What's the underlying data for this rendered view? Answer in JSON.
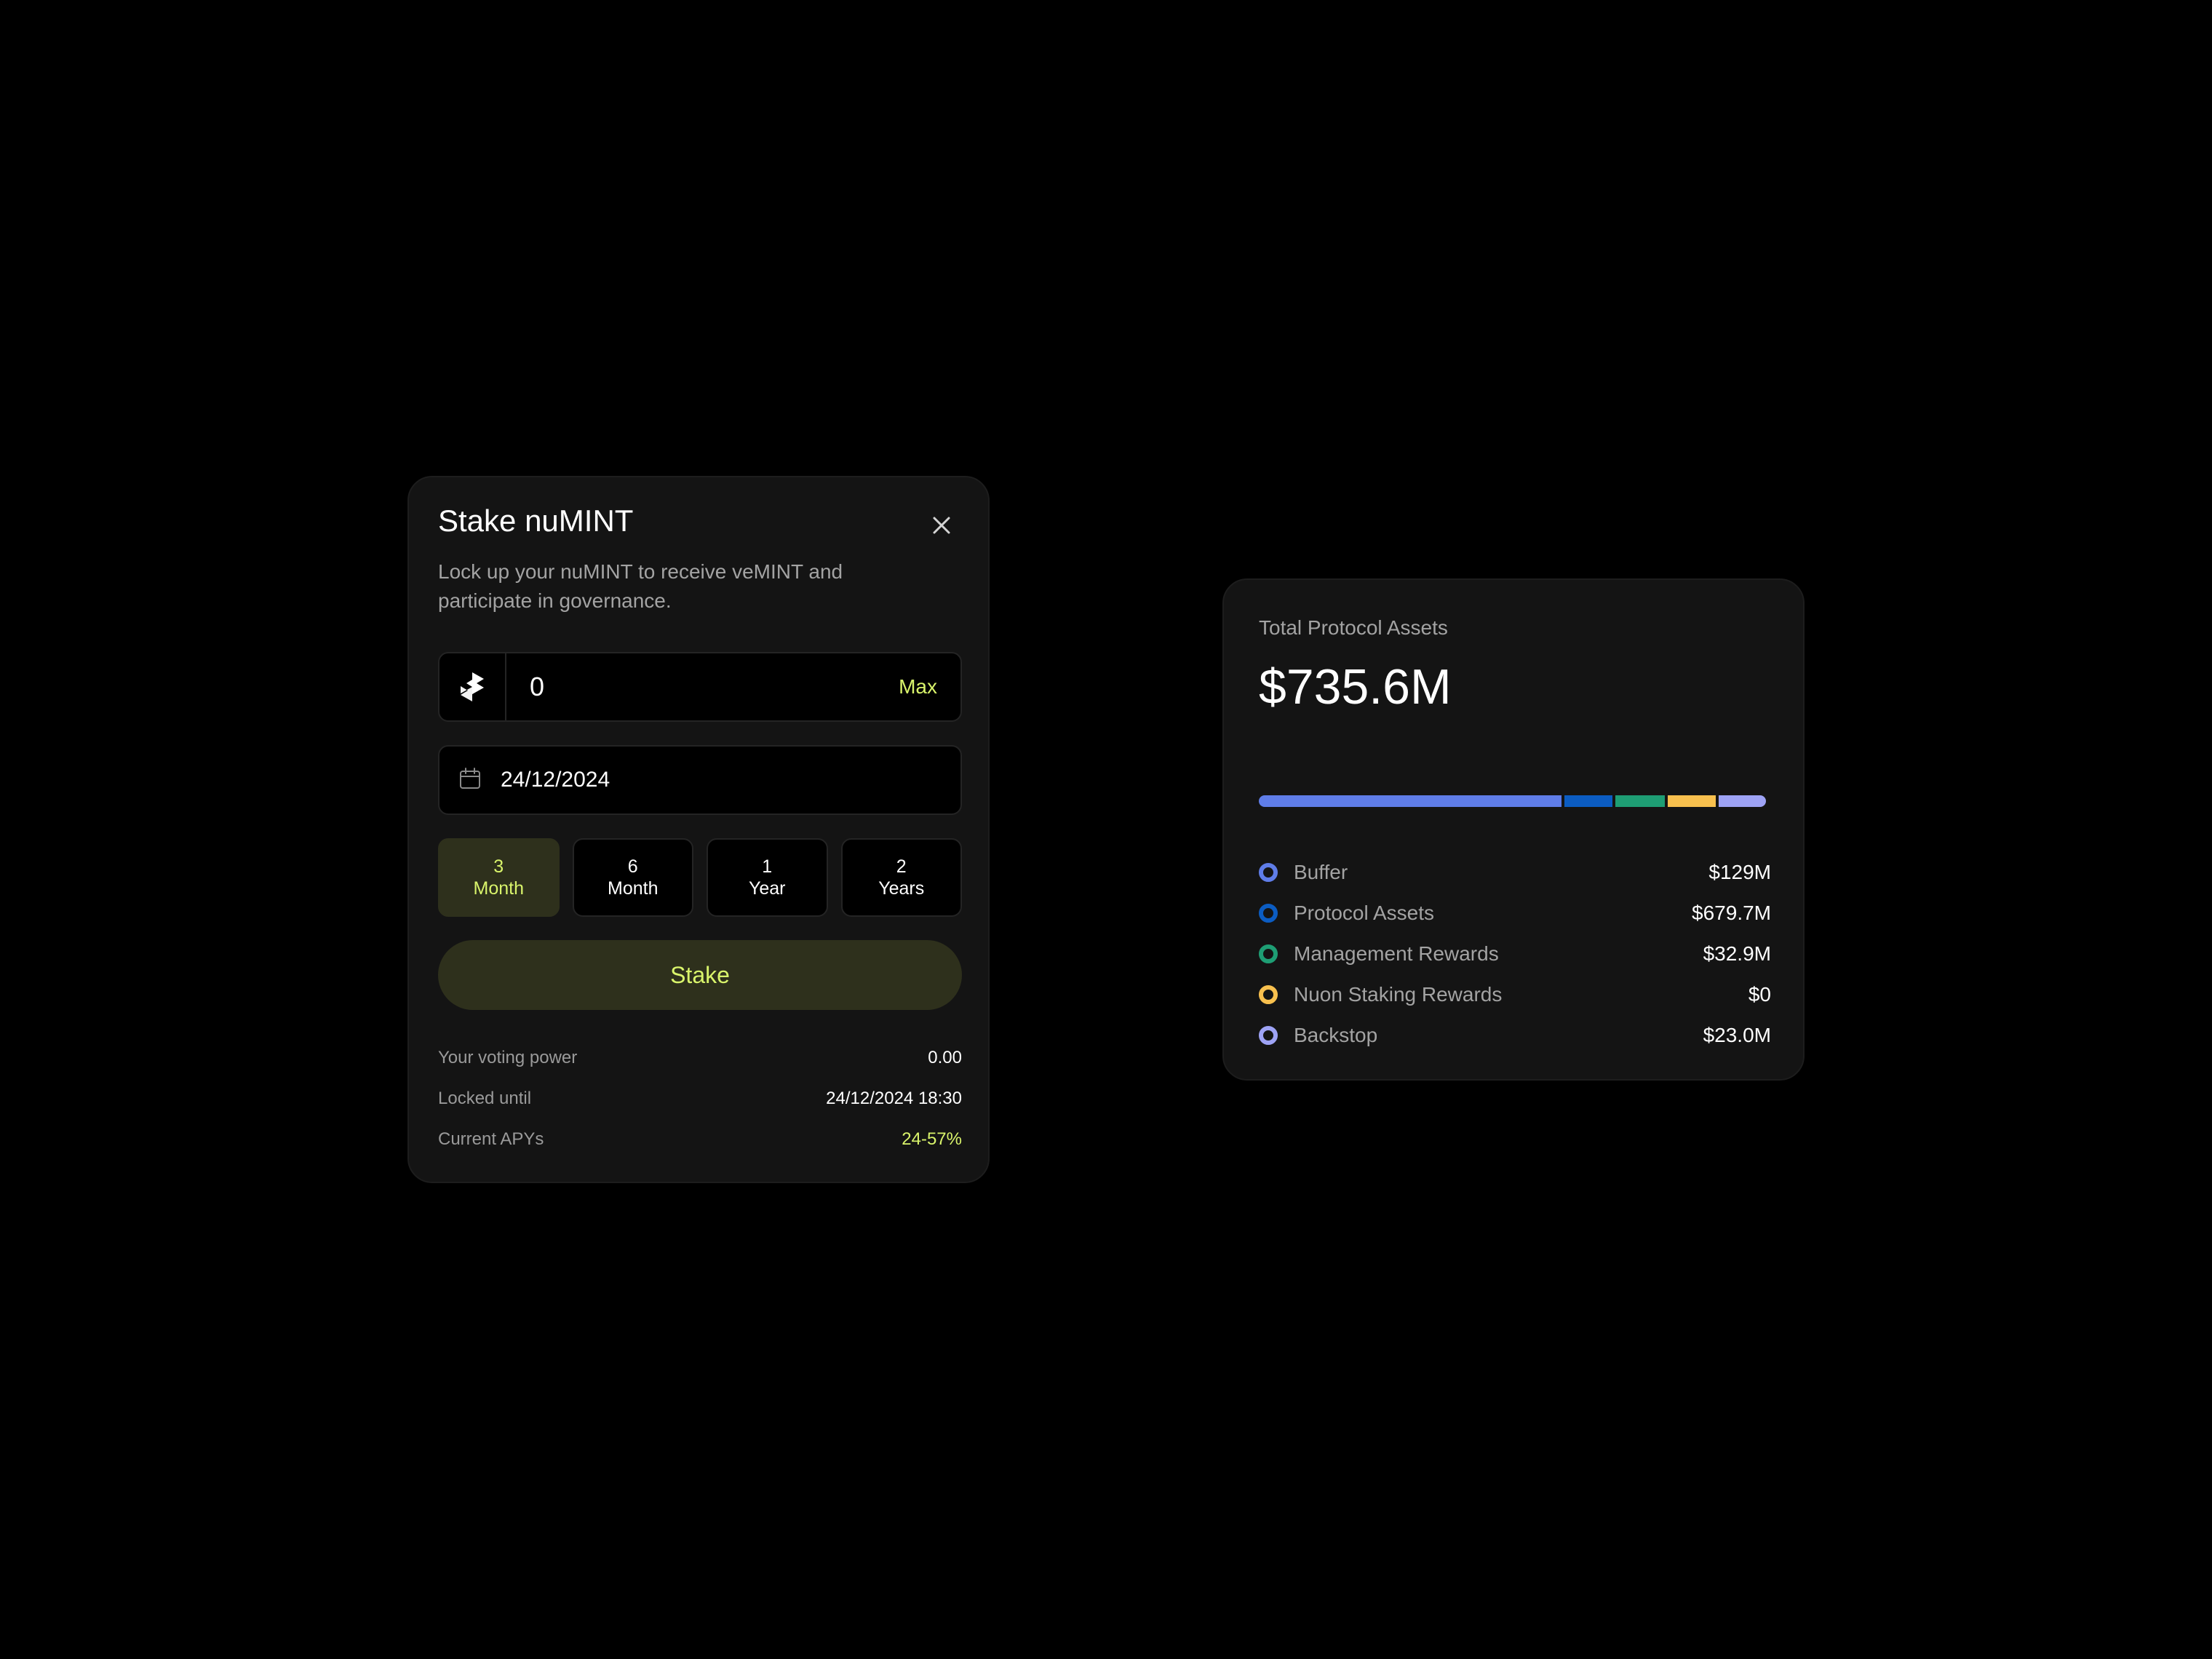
{
  "stake": {
    "title": "Stake nuMINT",
    "description": "Lock up your nuMINT to receive veMINT and participate in governance.",
    "amount_value": "0",
    "max_label": "Max",
    "date_value": "24/12/2024",
    "periods": [
      {
        "line1": "3",
        "line2": "Month",
        "active": true
      },
      {
        "line1": "6",
        "line2": "Month",
        "active": false
      },
      {
        "line1": "1",
        "line2": "Year",
        "active": false
      },
      {
        "line1": "2",
        "line2": "Years",
        "active": false
      }
    ],
    "stake_label": "Stake",
    "info": [
      {
        "label": "Your voting power",
        "value": "0.00"
      },
      {
        "label": "Locked until",
        "value": "24/12/2024 18:30"
      },
      {
        "label": "Current APYs",
        "value": "24-57%"
      }
    ],
    "accent_color": "#d9f46b"
  },
  "assets": {
    "label": "Total Protocol Assets",
    "total": "$735.6M",
    "items": [
      {
        "name": "Buffer",
        "value": "$129M",
        "color": "#5f7de8",
        "bar_share": 0.605
      },
      {
        "name": "Protocol Assets",
        "value": "$679.7M",
        "color": "#0b5cc2",
        "bar_share": 0.095
      },
      {
        "name": "Management Rewards",
        "value": "$32.9M",
        "color": "#1e9e74",
        "bar_share": 0.1
      },
      {
        "name": "Nuon Staking Rewards",
        "value": "$0",
        "color": "#f8c04e",
        "bar_share": 0.095
      },
      {
        "name": "Backstop",
        "value": "$23.0M",
        "color": "#9ea3f5",
        "bar_share": 0.095
      }
    ]
  }
}
